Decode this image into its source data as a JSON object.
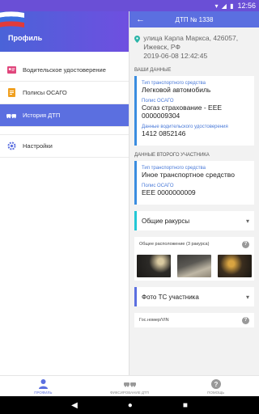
{
  "status_bar": {
    "time": "12:56"
  },
  "sidebar": {
    "title": "Профиль",
    "items": [
      {
        "label": "Водительское удостоверение",
        "icon": "license-icon",
        "color": "#e0467c"
      },
      {
        "label": "Полисы ОСАГО",
        "icon": "document-icon",
        "color": "#f0a020"
      },
      {
        "label": "История ДТП",
        "icon": "cars-icon",
        "color": "#ffffff",
        "active": true
      },
      {
        "label": "Настройки",
        "icon": "gear-icon",
        "color": "#5b6fe0"
      }
    ]
  },
  "main": {
    "appbar_title": "ДТП № 1338",
    "address": "улица Карла Маркса, 426057, Ижевск, РФ",
    "datetime": "2019-06-08 12:42:45",
    "my_data": {
      "section_title": "ВАШИ ДАННЫЕ",
      "vehicle_type_label": "Тип транспортного средства",
      "vehicle_type_value": "Легковой автомобиль",
      "policy_label": "Полис ОСАГО",
      "policy_value": "Согаз страхование - ЕЕЕ 0000009304",
      "license_label": "Данные водительского удостоверения",
      "license_value": "1412 0852146"
    },
    "second_participant": {
      "section_title": "ДАННЫЕ ВТОРОГО УЧАСТНИКА",
      "vehicle_type_label": "Тип транспортного средства",
      "vehicle_type_value": "Иное транспортное средство",
      "policy_label": "Полис ОСАГО",
      "policy_value": "ЕЕЕ 0000000009"
    },
    "general_angles": {
      "title": "Общие ракурсы",
      "subtitle": "Общее расположение (3 ракурса)"
    },
    "participant_photo": {
      "title": "Фото ТС участника",
      "subtitle": "Гос.номер/VIN"
    }
  },
  "bottom_nav": [
    {
      "label": "ПРОФИЛЬ",
      "icon": "person-icon",
      "active": true
    },
    {
      "label": "ФИКСИРОВАНИЕ ДТП",
      "icon": "cars-icon",
      "active": false
    },
    {
      "label": "ПОМОЩЬ",
      "icon": "help-icon",
      "active": false
    }
  ],
  "colors": {
    "accent": "#5b6fe0",
    "header_gradient_end": "#6f4fe0",
    "cyan": "#22c7d5"
  }
}
